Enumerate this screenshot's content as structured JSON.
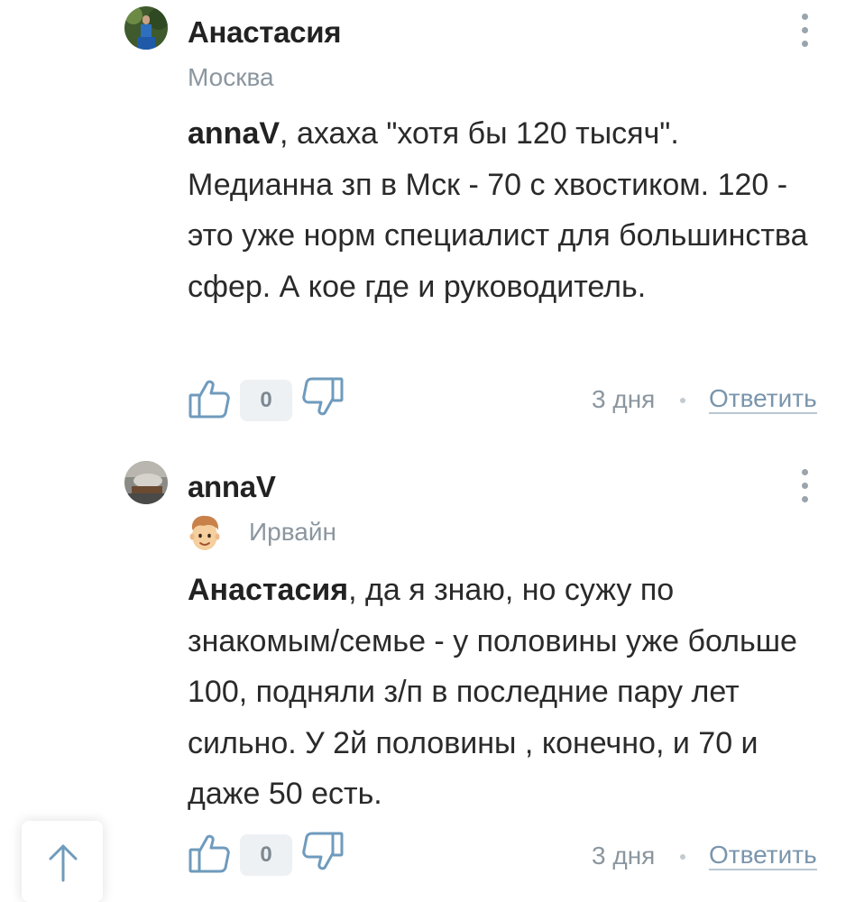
{
  "comments": [
    {
      "author": "Анастасия",
      "city": "Москва",
      "text_mention": "annaV",
      "text_body": ", ахаха \"хотя бы 120 тысяч\". Медианна зп в Мск - 70 с хвостиком. 120 - это уже норм специалист для большинства сфер. А кое где и руководитель.",
      "likes": "0",
      "time": "3 дня",
      "reply_label": "Ответить"
    },
    {
      "author": "annaV",
      "city": "Ирвайн",
      "text_mention": "Анастасия",
      "text_body": ", да я знаю, но сужу по знакомым/семье - у половины уже больше 100, подняли з/п в последние пару лет сильно. У 2й половины , конечно, и 70 и даже 50 есть.",
      "likes": "0",
      "time": "3 дня",
      "reply_label": "Ответить"
    }
  ],
  "icons": {
    "more": "more-vertical-icon",
    "like": "thumbs-up-icon",
    "dislike": "thumbs-down-icon",
    "scroll_up": "arrow-up-icon",
    "badge": "emoji-face-icon"
  },
  "colors": {
    "accent_link": "#7a95ac",
    "muted_text": "#8b969f",
    "counter_bg": "#edf1f4"
  }
}
